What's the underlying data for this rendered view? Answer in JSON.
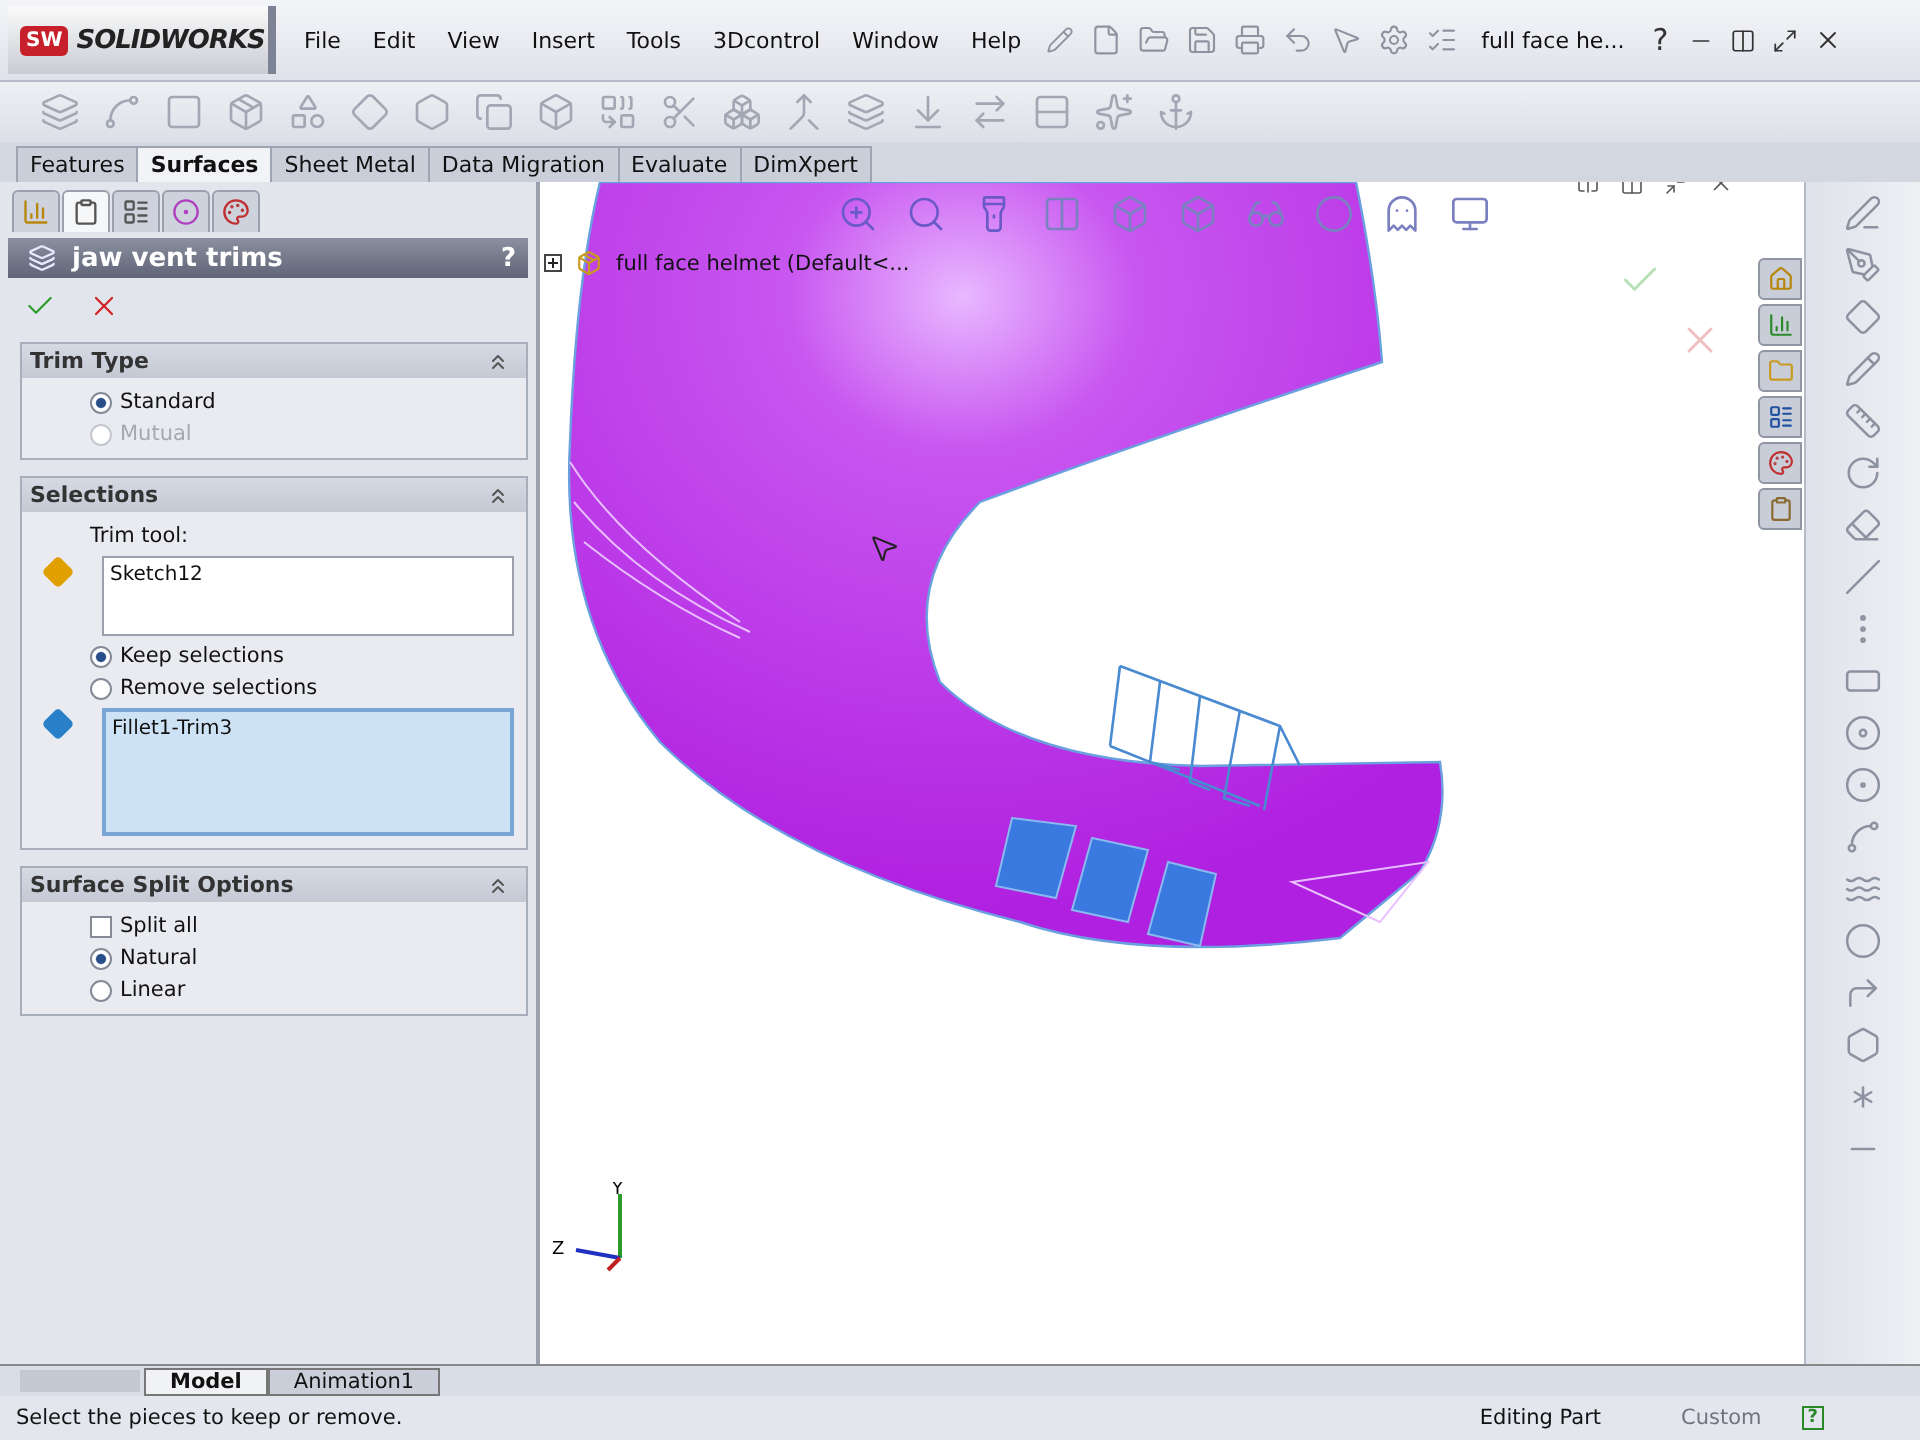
{
  "app": {
    "badge": "SW",
    "name": "SOLIDWORKS"
  },
  "menu": [
    "File",
    "Edit",
    "View",
    "Insert",
    "Tools",
    "3Dcontrol",
    "Window",
    "Help"
  ],
  "document_title": "full face he...",
  "help_button": "?",
  "command_tabs": [
    {
      "label": "Features",
      "selected": false
    },
    {
      "label": "Surfaces",
      "selected": true
    },
    {
      "label": "Sheet Metal",
      "selected": false
    },
    {
      "label": "Data Migration",
      "selected": false
    },
    {
      "label": "Evaluate",
      "selected": false
    },
    {
      "label": "DimXpert",
      "selected": false
    }
  ],
  "panel_tabs": [
    {
      "selected": false
    },
    {
      "selected": true
    },
    {
      "selected": false
    },
    {
      "selected": false
    },
    {
      "selected": false
    }
  ],
  "feature": {
    "title": "jaw vent trims",
    "help": "?"
  },
  "sections": [
    {
      "title": "Trim Type",
      "expanded": true,
      "items": [
        {
          "kind": "radio",
          "label": "Standard",
          "selected": true,
          "disabled": false
        },
        {
          "kind": "radio",
          "label": "Mutual",
          "selected": false,
          "disabled": true
        }
      ]
    },
    {
      "title": "Selections",
      "expanded": true,
      "items": [
        {
          "kind": "caption",
          "label": "Trim tool:"
        },
        {
          "kind": "list",
          "value": "Sketch12",
          "active": false
        },
        {
          "kind": "radio",
          "label": "Keep selections",
          "selected": true,
          "disabled": false
        },
        {
          "kind": "radio",
          "label": "Remove selections",
          "selected": false,
          "disabled": false
        },
        {
          "kind": "list",
          "value": "Fillet1-Trim3",
          "active": true
        }
      ]
    },
    {
      "title": "Surface Split Options",
      "expanded": true,
      "items": [
        {
          "kind": "checkbox",
          "label": "Split all",
          "checked": false
        },
        {
          "kind": "radio",
          "label": "Natural",
          "selected": true,
          "disabled": false
        },
        {
          "kind": "radio",
          "label": "Linear",
          "selected": false,
          "disabled": false
        }
      ]
    }
  ],
  "tree": {
    "label": "full face helmet  (Default<...",
    "expanded": false
  },
  "triad": {
    "z": "Z",
    "y": "Y"
  },
  "bottom_tabs": [
    {
      "label": "Model",
      "selected": true
    },
    {
      "label": "Animation1",
      "selected": false
    }
  ],
  "status_bar": {
    "message": "Select the pieces to keep or remove.",
    "mode": "Editing Part",
    "units": "Custom",
    "help": "?"
  }
}
